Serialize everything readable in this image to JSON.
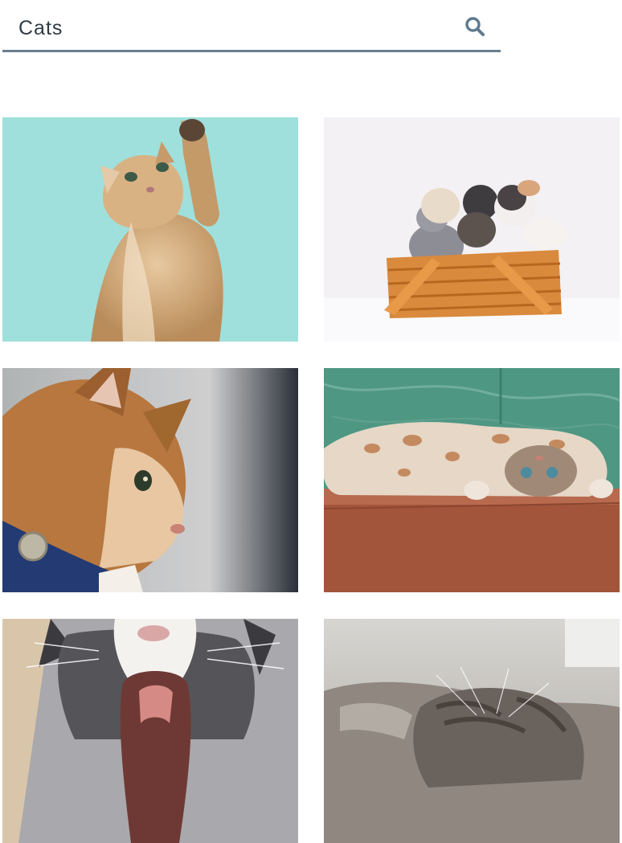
{
  "search": {
    "value": "Cats",
    "icon": "search-icon",
    "accent_color": "#5e7a8f",
    "underline_color": "#6b7f8e"
  },
  "results": [
    {
      "subject": "kitten-reaching-paw-icon",
      "background": "#9fe0dc"
    },
    {
      "subject": "kittens-in-basket-icon",
      "background": "#f3f1f4"
    },
    {
      "subject": "ginger-cat-blue-collar-icon",
      "background": "#b9b5b2"
    },
    {
      "subject": "cat-lying-upside-down-icon",
      "background": "#4e9783"
    },
    {
      "subject": "cat-yawning-icon",
      "background": "#d9c6aa"
    },
    {
      "subject": "tabby-cat-resting-icon",
      "background": "#c8c6c2"
    }
  ]
}
